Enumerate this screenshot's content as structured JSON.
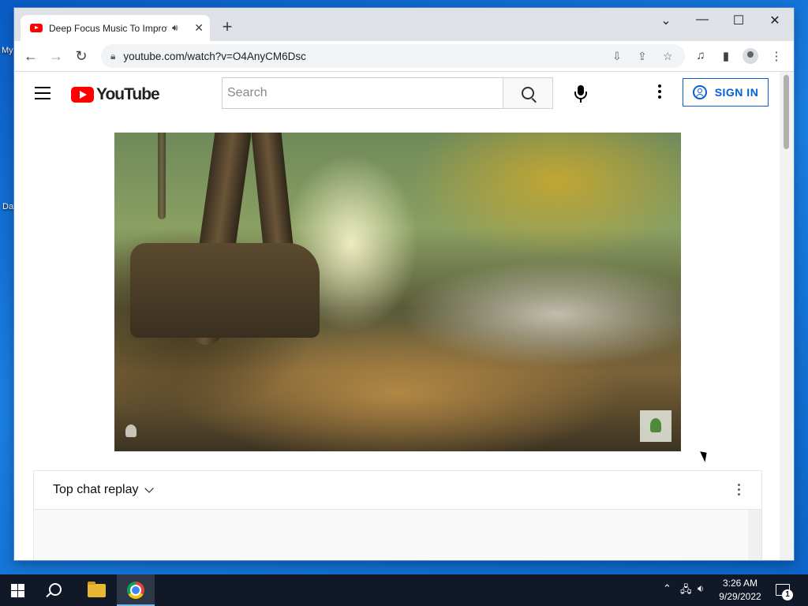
{
  "desktop": {
    "labels": [
      "My",
      "Da"
    ]
  },
  "browser": {
    "tab": {
      "title": "Deep Focus Music To Improve",
      "audio_icon": "speaker-icon",
      "close_glyph": "✕"
    },
    "new_tab_glyph": "+",
    "window_controls": {
      "tab_search": "⌄",
      "minimize": "—",
      "maximize": "☐",
      "close": "✕"
    },
    "toolbar": {
      "back": "←",
      "forward": "→",
      "reload": "↻",
      "url": "youtube.com/watch?v=O4AnyCM6Dsc"
    }
  },
  "youtube": {
    "logo_text": "YouTube",
    "search": {
      "placeholder": "Search"
    },
    "sign_in_label": "SIGN IN",
    "chat": {
      "title": "Top chat replay"
    }
  },
  "taskbar": {
    "clock": {
      "time": "3:26 AM",
      "date": "9/29/2022"
    },
    "notification_count": "1"
  },
  "colors": {
    "youtube_red": "#ff0000",
    "link_blue": "#065fd4",
    "taskbar": "#111827",
    "desktop": "#1a7ee0"
  }
}
